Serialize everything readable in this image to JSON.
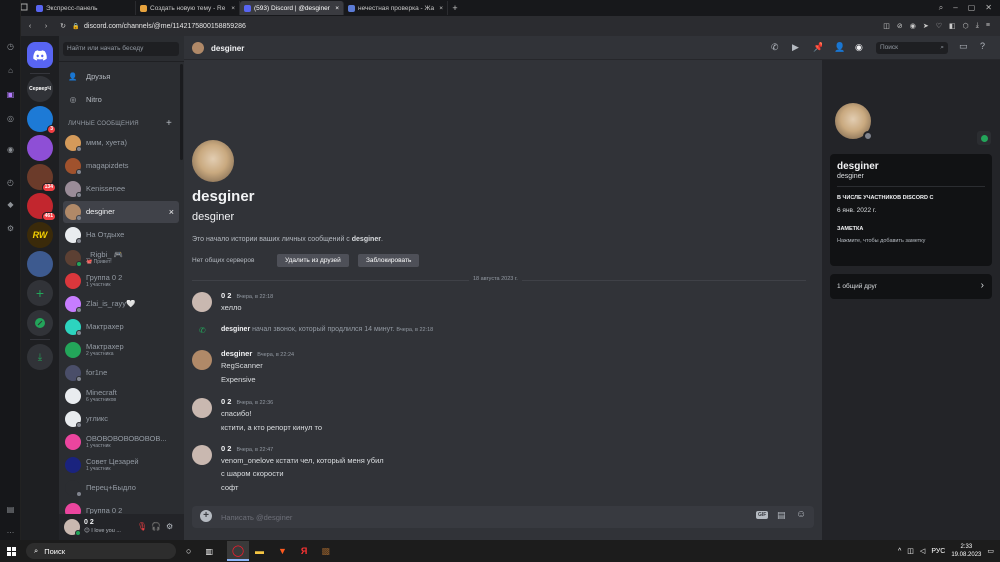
{
  "browser": {
    "tabs": [
      {
        "label": "Экспресс-панель",
        "color": "#5865f2"
      },
      {
        "label": "Создать новую тему - Re",
        "color": "#e7a33e"
      },
      {
        "label": "(593) Discord | @desginer",
        "color": "#5865f2"
      },
      {
        "label": "нечестная проверка - Жа",
        "color": "#5b7bd5"
      }
    ],
    "url": "discord.com/channels/@me/1142175800158859286"
  },
  "servers": [
    {
      "label": "",
      "color": "#5865f2",
      "badge": ""
    },
    {
      "label": "СерверЧ",
      "color": "#313338",
      "badge": ""
    },
    {
      "label": "",
      "color": "#1d7ad6",
      "badge": "3"
    },
    {
      "label": "",
      "color": "#8e4fd6",
      "badge": ""
    },
    {
      "label": "",
      "color": "#6b3b2a",
      "badge": "134"
    },
    {
      "label": "",
      "color": "#c2262e",
      "badge": "461"
    },
    {
      "label": "RW",
      "color": "#3a2a0a",
      "badge": ""
    },
    {
      "label": "",
      "color": "#3d5a8f",
      "badge": ""
    }
  ],
  "dmlist": {
    "search_placeholder": "Найти или начать беседу",
    "friends": "Друзья",
    "nitro": "Nitro",
    "section_title": "ЛИЧНЫЕ СООБЩЕНИЯ",
    "items": [
      {
        "name": "ммм, хуета)",
        "sub": "",
        "color": "#d49a5a",
        "status": "#80848e"
      },
      {
        "name": "magapizdets",
        "sub": "",
        "color": "#a0522d",
        "status": "#80848e"
      },
      {
        "name": "Kenissenee",
        "sub": "",
        "color": "#9a8c98",
        "status": "#80848e"
      },
      {
        "name": "desginer",
        "sub": "",
        "color": "#b08968",
        "status": "#80848e"
      },
      {
        "name": "На Отдыхе",
        "sub": "",
        "color": "#e9ecef",
        "status": "#80848e"
      },
      {
        "name": "_Rigbi_ 🎮",
        "sub": "🐙 Привет!",
        "color": "#5c4033",
        "status": "#23a55a"
      },
      {
        "name": "Группа 0 2",
        "sub": "1 участник",
        "color": "#da373c",
        "status": ""
      },
      {
        "name": "Zlai_is_rayy🤍",
        "sub": "",
        "color": "#c77dff",
        "status": "#80848e"
      },
      {
        "name": "Мактрахер",
        "sub": "",
        "color": "#2dd4bf",
        "status": "#80848e"
      },
      {
        "name": "Мактрахер",
        "sub": "2 участника",
        "color": "#23a55a",
        "status": ""
      },
      {
        "name": "for1ne",
        "sub": "",
        "color": "#4a4e69",
        "status": "#80848e"
      },
      {
        "name": "Minecraft",
        "sub": "6 участников",
        "color": "#e9ecef",
        "status": ""
      },
      {
        "name": "угликс",
        "sub": "",
        "color": "#e9ecef",
        "status": "#80848e"
      },
      {
        "name": "ОВОВОВОВОВОВОВ...",
        "sub": "1 участник",
        "color": "#eb459e",
        "status": ""
      },
      {
        "name": "Совет Цезарей",
        "sub": "1 участник",
        "color": "#1a237e",
        "status": ""
      },
      {
        "name": "Перец+Быдло",
        "sub": "",
        "color": "#2b2d31",
        "status": "#80848e"
      },
      {
        "name": "Группа 0 2",
        "sub": "",
        "color": "#eb459e",
        "status": ""
      }
    ],
    "user": {
      "name": "0 2",
      "status_text": "😊 I love you ..."
    }
  },
  "chat": {
    "header_name": "desginer",
    "search_placeholder": "Поиск",
    "intro_display": "desginer",
    "intro_username": "desginer",
    "intro_text": "Это начало истории ваших личных сообщений с",
    "intro_text_bold": "desginer",
    "no_servers": "Нет общих серверов",
    "remove_friend": "Удалить из друзей",
    "block": "Заблокировать",
    "date_divider": "18 августа 2023 г.",
    "messages": [
      {
        "author": "0 2",
        "time": "Вчера, в 22:18",
        "lines": [
          "хелло"
        ]
      },
      {
        "author": "desginer",
        "time": "Вчера, в 22:24",
        "lines": [
          "RegScanner",
          "Expensive"
        ]
      },
      {
        "author": "0 2",
        "time": "Вчера, в 22:36",
        "lines": [
          "спасибо!",
          "кстити, а кто репорт кинул то"
        ]
      },
      {
        "author": "0 2",
        "time": "Вчера, в 22:47",
        "lines": [
          "venom_onelove кстати чел, который меня убил",
          "с шаром скорости",
          "софт"
        ]
      }
    ],
    "call": {
      "author": "desginer",
      "text": "начал звонок, который продлился 14 минут.",
      "time": "Вчера, в 22:18"
    },
    "input_placeholder": "Написать @desginer"
  },
  "profile": {
    "display": "desginer",
    "username": "desginer",
    "member_since_title": "В ЧИСЛЕ УЧАСТНИКОВ DISCORD С",
    "member_since": "6 янв. 2022 г.",
    "note_title": "ЗАМЕТКА",
    "note_placeholder": "Нажмите, чтобы добавить заметку",
    "mutual_friends": "1 общий друг"
  },
  "taskbar": {
    "search": "Поиск",
    "lang": "РУС",
    "time": "2:33",
    "date": "19.08.2023"
  }
}
